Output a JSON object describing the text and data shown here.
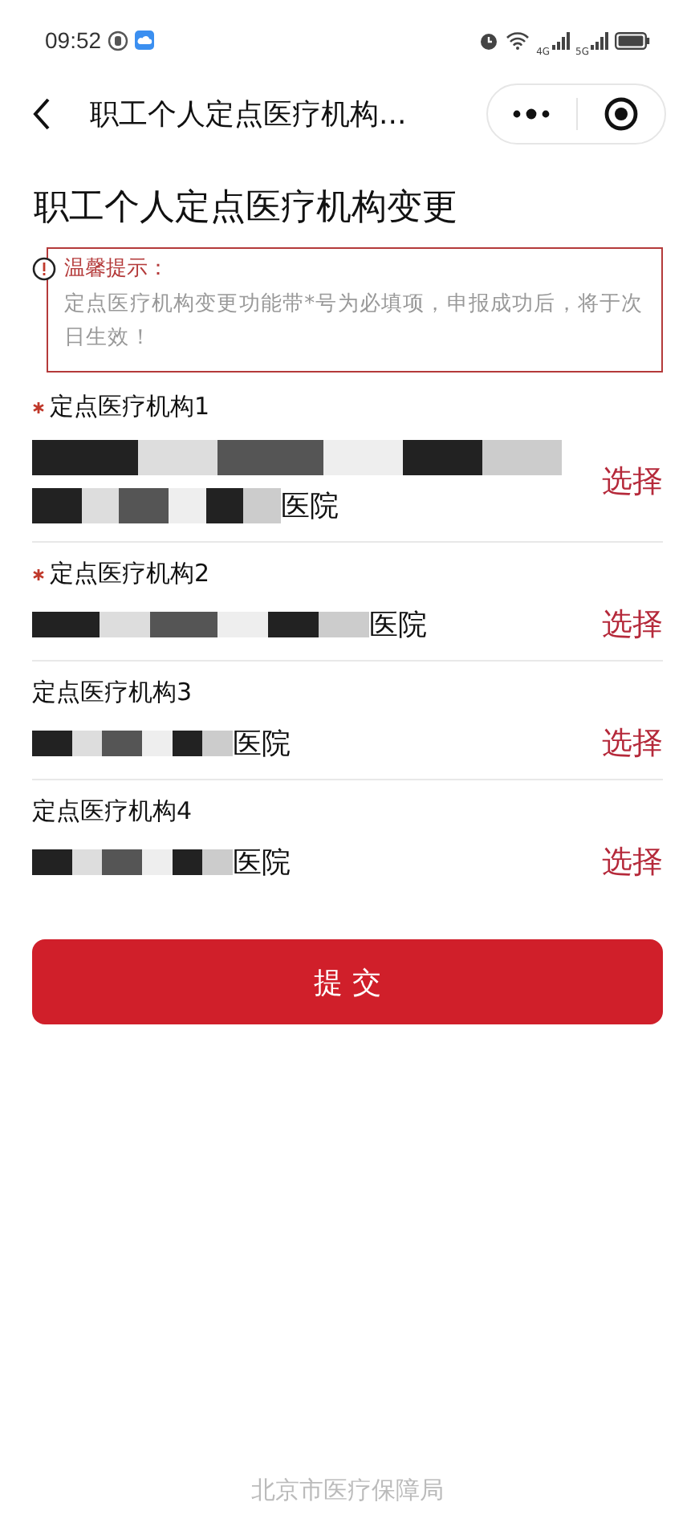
{
  "status_bar": {
    "time": "09:52",
    "network_labels": [
      "4G",
      "5G"
    ]
  },
  "nav_bar": {
    "title": "职工个人定点医疗机构..."
  },
  "page_title": "职工个人定点医疗机构变更",
  "notice": {
    "heading": "温馨提示：",
    "text": "定点医疗机构变更功能带*号为必填项，申报成功后，将于次日生效！"
  },
  "institutions": [
    {
      "label": "定点医疗机构1",
      "required": true,
      "kind": "two_line",
      "value": "医院",
      "action": "选择"
    },
    {
      "label": "定点医疗机构2",
      "required": true,
      "kind": "one_line",
      "value": "医院",
      "action": "选择"
    },
    {
      "label": "定点医疗机构3",
      "required": false,
      "kind": "one_line",
      "value": "医院",
      "action": "选择"
    },
    {
      "label": "定点医疗机构4",
      "required": false,
      "kind": "one_line",
      "value": "医院",
      "action": "选择"
    }
  ],
  "submit_button": "提 交",
  "footer": "北京市医疗保障局"
}
